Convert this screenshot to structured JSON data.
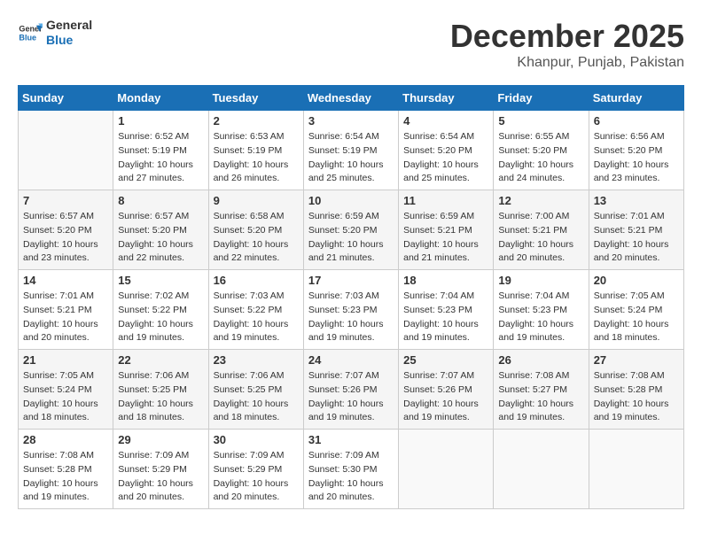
{
  "header": {
    "logo_general": "General",
    "logo_blue": "Blue",
    "month_title": "December 2025",
    "location": "Khanpur, Punjab, Pakistan"
  },
  "weekdays": [
    "Sunday",
    "Monday",
    "Tuesday",
    "Wednesday",
    "Thursday",
    "Friday",
    "Saturday"
  ],
  "weeks": [
    [
      {
        "day": "",
        "info": ""
      },
      {
        "day": "1",
        "info": "Sunrise: 6:52 AM\nSunset: 5:19 PM\nDaylight: 10 hours\nand 27 minutes."
      },
      {
        "day": "2",
        "info": "Sunrise: 6:53 AM\nSunset: 5:19 PM\nDaylight: 10 hours\nand 26 minutes."
      },
      {
        "day": "3",
        "info": "Sunrise: 6:54 AM\nSunset: 5:19 PM\nDaylight: 10 hours\nand 25 minutes."
      },
      {
        "day": "4",
        "info": "Sunrise: 6:54 AM\nSunset: 5:20 PM\nDaylight: 10 hours\nand 25 minutes."
      },
      {
        "day": "5",
        "info": "Sunrise: 6:55 AM\nSunset: 5:20 PM\nDaylight: 10 hours\nand 24 minutes."
      },
      {
        "day": "6",
        "info": "Sunrise: 6:56 AM\nSunset: 5:20 PM\nDaylight: 10 hours\nand 23 minutes."
      }
    ],
    [
      {
        "day": "7",
        "info": "Sunrise: 6:57 AM\nSunset: 5:20 PM\nDaylight: 10 hours\nand 23 minutes."
      },
      {
        "day": "8",
        "info": "Sunrise: 6:57 AM\nSunset: 5:20 PM\nDaylight: 10 hours\nand 22 minutes."
      },
      {
        "day": "9",
        "info": "Sunrise: 6:58 AM\nSunset: 5:20 PM\nDaylight: 10 hours\nand 22 minutes."
      },
      {
        "day": "10",
        "info": "Sunrise: 6:59 AM\nSunset: 5:20 PM\nDaylight: 10 hours\nand 21 minutes."
      },
      {
        "day": "11",
        "info": "Sunrise: 6:59 AM\nSunset: 5:21 PM\nDaylight: 10 hours\nand 21 minutes."
      },
      {
        "day": "12",
        "info": "Sunrise: 7:00 AM\nSunset: 5:21 PM\nDaylight: 10 hours\nand 20 minutes."
      },
      {
        "day": "13",
        "info": "Sunrise: 7:01 AM\nSunset: 5:21 PM\nDaylight: 10 hours\nand 20 minutes."
      }
    ],
    [
      {
        "day": "14",
        "info": "Sunrise: 7:01 AM\nSunset: 5:21 PM\nDaylight: 10 hours\nand 20 minutes."
      },
      {
        "day": "15",
        "info": "Sunrise: 7:02 AM\nSunset: 5:22 PM\nDaylight: 10 hours\nand 19 minutes."
      },
      {
        "day": "16",
        "info": "Sunrise: 7:03 AM\nSunset: 5:22 PM\nDaylight: 10 hours\nand 19 minutes."
      },
      {
        "day": "17",
        "info": "Sunrise: 7:03 AM\nSunset: 5:23 PM\nDaylight: 10 hours\nand 19 minutes."
      },
      {
        "day": "18",
        "info": "Sunrise: 7:04 AM\nSunset: 5:23 PM\nDaylight: 10 hours\nand 19 minutes."
      },
      {
        "day": "19",
        "info": "Sunrise: 7:04 AM\nSunset: 5:23 PM\nDaylight: 10 hours\nand 19 minutes."
      },
      {
        "day": "20",
        "info": "Sunrise: 7:05 AM\nSunset: 5:24 PM\nDaylight: 10 hours\nand 18 minutes."
      }
    ],
    [
      {
        "day": "21",
        "info": "Sunrise: 7:05 AM\nSunset: 5:24 PM\nDaylight: 10 hours\nand 18 minutes."
      },
      {
        "day": "22",
        "info": "Sunrise: 7:06 AM\nSunset: 5:25 PM\nDaylight: 10 hours\nand 18 minutes."
      },
      {
        "day": "23",
        "info": "Sunrise: 7:06 AM\nSunset: 5:25 PM\nDaylight: 10 hours\nand 18 minutes."
      },
      {
        "day": "24",
        "info": "Sunrise: 7:07 AM\nSunset: 5:26 PM\nDaylight: 10 hours\nand 19 minutes."
      },
      {
        "day": "25",
        "info": "Sunrise: 7:07 AM\nSunset: 5:26 PM\nDaylight: 10 hours\nand 19 minutes."
      },
      {
        "day": "26",
        "info": "Sunrise: 7:08 AM\nSunset: 5:27 PM\nDaylight: 10 hours\nand 19 minutes."
      },
      {
        "day": "27",
        "info": "Sunrise: 7:08 AM\nSunset: 5:28 PM\nDaylight: 10 hours\nand 19 minutes."
      }
    ],
    [
      {
        "day": "28",
        "info": "Sunrise: 7:08 AM\nSunset: 5:28 PM\nDaylight: 10 hours\nand 19 minutes."
      },
      {
        "day": "29",
        "info": "Sunrise: 7:09 AM\nSunset: 5:29 PM\nDaylight: 10 hours\nand 20 minutes."
      },
      {
        "day": "30",
        "info": "Sunrise: 7:09 AM\nSunset: 5:29 PM\nDaylight: 10 hours\nand 20 minutes."
      },
      {
        "day": "31",
        "info": "Sunrise: 7:09 AM\nSunset: 5:30 PM\nDaylight: 10 hours\nand 20 minutes."
      },
      {
        "day": "",
        "info": ""
      },
      {
        "day": "",
        "info": ""
      },
      {
        "day": "",
        "info": ""
      }
    ]
  ]
}
